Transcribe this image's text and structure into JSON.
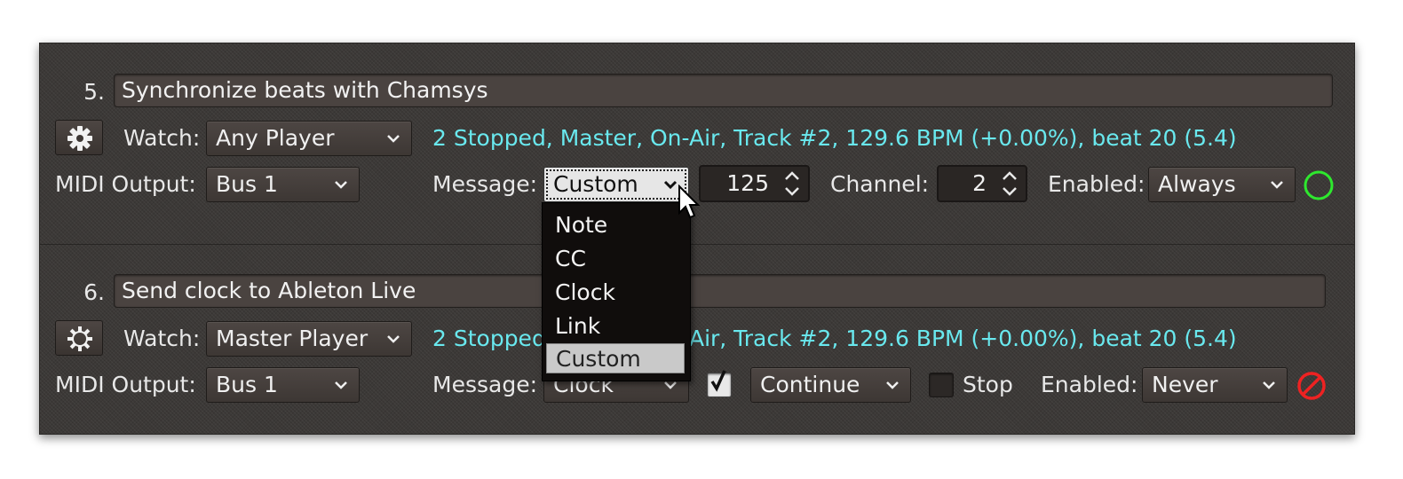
{
  "triggers": [
    {
      "number": "5.",
      "name": "Synchronize beats with Chamsys",
      "watch_label": "Watch:",
      "watch_value": "Any Player",
      "status": "2 Stopped, Master, On-Air, Track #2, 129.6 BPM (+0.00%), beat 20 (5.4)",
      "midi_output_label": "MIDI Output:",
      "midi_output_value": "Bus 1",
      "message_label": "Message:",
      "message_value": "Custom",
      "note_value": "125",
      "channel_label": "Channel:",
      "channel_value": "2",
      "enabled_label": "Enabled:",
      "enabled_value": "Always",
      "enabled_state_icon": "green-circle-icon",
      "gear_icon": "gear-filled-icon"
    },
    {
      "number": "6.",
      "name": "Send clock to Ableton Live",
      "watch_label": "Watch:",
      "watch_value": "Master Player",
      "status": "2 Stopped, Master, On-Air, Track #2, 129.6 BPM (+0.00%), beat 20 (5.4)",
      "midi_output_label": "MIDI Output:",
      "midi_output_value": "Bus 1",
      "message_label": "Message:",
      "message_value": "Clock",
      "send_checkbox_checked": true,
      "send_value": "Continue",
      "stop_label": "Stop",
      "stop_checked": false,
      "enabled_label": "Enabled:",
      "enabled_value": "Never",
      "enabled_state_icon": "red-prohibited-icon",
      "gear_icon": "gear-outline-icon"
    }
  ],
  "message_dropdown": {
    "options": [
      "Note",
      "CC",
      "Clock",
      "Link",
      "Custom"
    ],
    "selected": "Custom"
  },
  "colors": {
    "status_text": "#69e8ee",
    "enabled_ok": "#2ee82e",
    "enabled_never": "#ee2222",
    "panel_bg": "#3c3937"
  }
}
